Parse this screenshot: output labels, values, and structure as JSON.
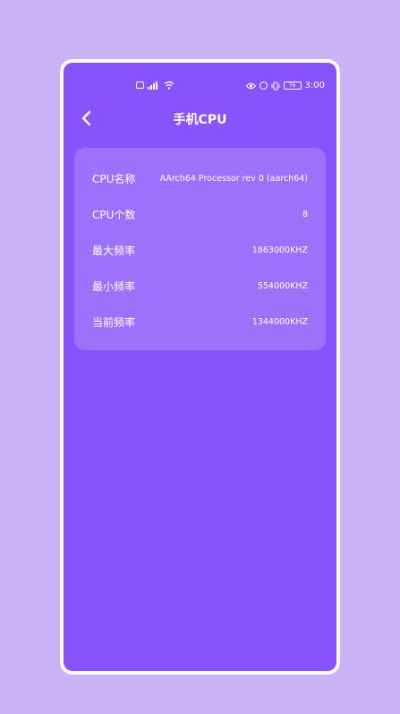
{
  "status_bar": {
    "battery": "76",
    "time": "3:00",
    "signal": "4G"
  },
  "header": {
    "title": "手机CPU"
  },
  "cpu_info": {
    "rows": [
      {
        "label": "CPU名称",
        "value": "AArch64 Processor rev 0 (aarch64)"
      },
      {
        "label": "CPU个数",
        "value": "8"
      },
      {
        "label": "最大频率",
        "value": "1863000KHZ"
      },
      {
        "label": "最小频率",
        "value": "554000KHZ"
      },
      {
        "label": "当前频率",
        "value": "1344000KHZ"
      }
    ]
  }
}
